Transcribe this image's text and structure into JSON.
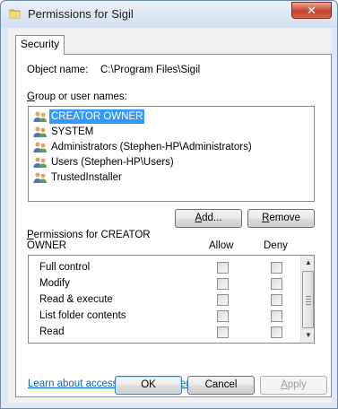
{
  "window": {
    "title": "Permissions for Sigil",
    "close_glyph": "✕"
  },
  "tabs": [
    {
      "label": "Security"
    }
  ],
  "object": {
    "label": "Object name:",
    "value": "C:\\Program Files\\Sigil"
  },
  "groups": {
    "label": "Group or user names:",
    "items": [
      {
        "label": "CREATOR OWNER",
        "selected": true
      },
      {
        "label": "SYSTEM",
        "selected": false
      },
      {
        "label": "Administrators (Stephen-HP\\Administrators)",
        "selected": false
      },
      {
        "label": "Users (Stephen-HP\\Users)",
        "selected": false
      },
      {
        "label": "TrustedInstaller",
        "selected": false
      }
    ],
    "add_label": "Add...",
    "remove_label": "Remove"
  },
  "permissions": {
    "label_line1": "Permissions for CREATOR",
    "label_line2": "OWNER",
    "allow_header": "Allow",
    "deny_header": "Deny",
    "rows": [
      {
        "label": "Full control",
        "allow": false,
        "deny": false
      },
      {
        "label": "Modify",
        "allow": false,
        "deny": false
      },
      {
        "label": "Read & execute",
        "allow": false,
        "deny": false
      },
      {
        "label": "List folder contents",
        "allow": false,
        "deny": false
      },
      {
        "label": "Read",
        "allow": false,
        "deny": false
      }
    ],
    "scroll_up_glyph": "▲",
    "scroll_down_glyph": "▼"
  },
  "link_text": "Learn about access control and permissions",
  "buttons": {
    "ok": "OK",
    "cancel": "Cancel",
    "apply": "Apply"
  },
  "colors": {
    "selection": "#3399ff",
    "link": "#0066cc",
    "close": "#c7422b"
  }
}
